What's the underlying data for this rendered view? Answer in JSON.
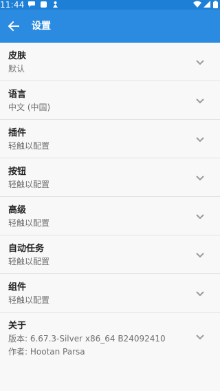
{
  "status_bar": {
    "time": "11:44",
    "icons_left": [
      "notification-icon",
      "tile-icon",
      "debug-icon"
    ],
    "icons_right": [
      "wifi-icon",
      "signal-icon",
      "battery-icon"
    ]
  },
  "app_bar": {
    "title": "设置",
    "back_icon": "arrow-left-icon",
    "color": "#2a8be0"
  },
  "settings": [
    {
      "title": "皮肤",
      "subtitle": "默认"
    },
    {
      "title": "语言",
      "subtitle": "中文 (中国)"
    },
    {
      "title": "插件",
      "subtitle": "轻触以配置"
    },
    {
      "title": "按钮",
      "subtitle": "轻触以配置"
    },
    {
      "title": "高级",
      "subtitle": "轻触以配置"
    },
    {
      "title": "自动任务",
      "subtitle": "轻触以配置"
    },
    {
      "title": "组件",
      "subtitle": "轻触以配置"
    },
    {
      "title": "关于",
      "subtitle": "版本: 6.67.3-Silver x86_64  B24092410",
      "subtitle2": "作者: Hootan Parsa"
    }
  ]
}
